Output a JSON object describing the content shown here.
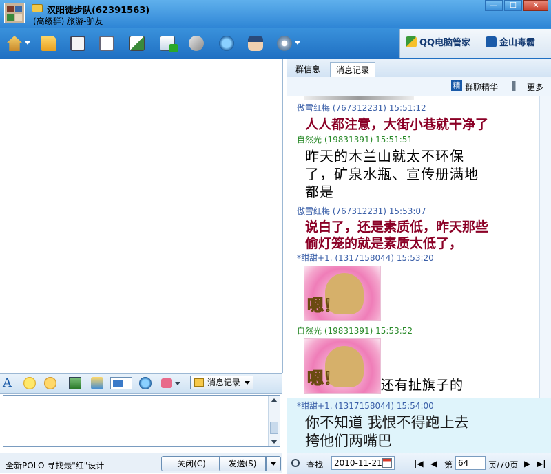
{
  "window": {
    "title": "汉阳徒步队(62391563)",
    "subtitle": "(高级群) 旅游-驴友",
    "controls": [
      "—",
      "☐",
      "✕"
    ]
  },
  "toolbar": {
    "icons": [
      "home-icon",
      "folder-icon",
      "album-icon",
      "card-icon",
      "poker-icon",
      "add-app-icon",
      "tools-icon",
      "search-icon",
      "officer-icon",
      "settings-icon"
    ],
    "vendors": [
      "QQ电脑管家",
      "金山毒霸"
    ]
  },
  "input_toolbar": {
    "msg_record_label": "消息记录"
  },
  "bottom": {
    "promo": "全新POLO 寻找最\"红\"设计",
    "close_label": "关闭(C)",
    "send_label": "发送(S)"
  },
  "right": {
    "tabs": [
      "群信息",
      "消息记录"
    ],
    "essence_badge": "精",
    "essence_label": "群聊精华",
    "more_label": "更多"
  },
  "messages": [
    {
      "sender": "傲雪红梅",
      "id": "(767312231)",
      "time": "15:51:12",
      "text": "人人都注意，大街小巷就干净了"
    },
    {
      "sender": "自然光",
      "id": "(19831391)",
      "time": "15:51:51",
      "text": "昨天的木兰山就太不环保了，矿泉水瓶、宣传册满地都是",
      "lines": [
        "昨天的木兰山就太不环保",
        "了，矿泉水瓶、宣传册满地",
        "都是"
      ]
    },
    {
      "sender": "傲雪红梅",
      "id": "(767312231)",
      "time": "15:53:07",
      "lines": [
        "说白了，还是素质低，昨天那些",
        "偷灯笼的就是素质太低了，"
      ]
    },
    {
      "sender": "*甜甜+1.",
      "id": "(1317158044)",
      "time": "15:53:20",
      "sticker_text": "嗯！"
    },
    {
      "sender": "自然光",
      "id": "(19831391)",
      "time": "15:53:52",
      "sticker_text": "嗯！",
      "text": "还有扯旗子的"
    },
    {
      "sender": "*甜甜+1.",
      "id": "(1317158044)",
      "time": "15:54:00",
      "lines": [
        "你不知道 我恨不得跑上去",
        "挎他们两嘴巴"
      ]
    }
  ],
  "pager": {
    "find_label": "查找",
    "date": "2010-11-21",
    "page_prefix": "第",
    "page_value": "64",
    "page_suffix": "页/70页"
  },
  "colors": {
    "title_blue": "#2f86d6",
    "sender_green": "#2a8a2a",
    "emphasis_red": "#8b0026"
  }
}
